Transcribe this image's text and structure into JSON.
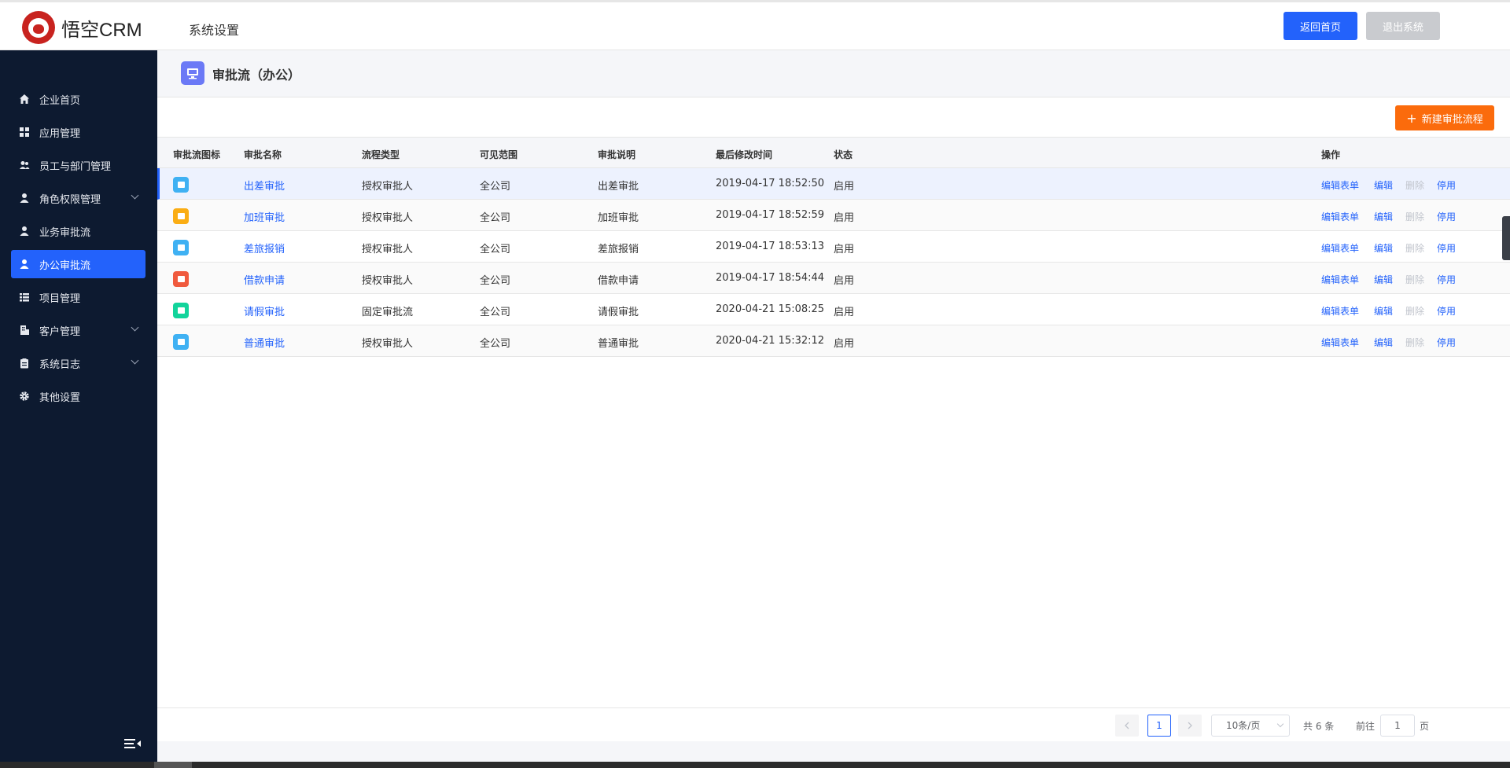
{
  "header": {
    "brand": "悟空CRM",
    "title": "系统设置",
    "home_label": "返回首页",
    "logout_label": "退出系统"
  },
  "sidebar": {
    "items": [
      {
        "label": "企业首页",
        "icon": "home-icon"
      },
      {
        "label": "应用管理",
        "icon": "grid-icon"
      },
      {
        "label": "员工与部门管理",
        "icon": "users-icon"
      },
      {
        "label": "角色权限管理",
        "icon": "user-icon",
        "has_arrow": true
      },
      {
        "label": "业务审批流",
        "icon": "user-icon"
      },
      {
        "label": "办公审批流",
        "icon": "user-icon",
        "active": true
      },
      {
        "label": "项目管理",
        "icon": "list-icon"
      },
      {
        "label": "客户管理",
        "icon": "building-icon",
        "has_arrow": true
      },
      {
        "label": "系统日志",
        "icon": "clipboard-icon",
        "has_arrow": true
      },
      {
        "label": "其他设置",
        "icon": "gear-icon"
      }
    ]
  },
  "page": {
    "title": "审批流（办公）",
    "new_button": "新建审批流程"
  },
  "table": {
    "headers": [
      "审批流图标",
      "审批名称",
      "流程类型",
      "可见范围",
      "审批说明",
      "最后修改时间",
      "状态",
      "操作"
    ],
    "rows": [
      {
        "icon_color": "#3fb1f3",
        "name": "出差审批",
        "type": "授权审批人",
        "scope": "全公司",
        "desc": "出差审批",
        "time": "2019-04-17 18:52:50",
        "status": "启用"
      },
      {
        "icon_color": "#faad14",
        "name": "加班审批",
        "type": "授权审批人",
        "scope": "全公司",
        "desc": "加班审批",
        "time": "2019-04-17 18:52:59",
        "status": "启用"
      },
      {
        "icon_color": "#3fb1f3",
        "name": "差旅报销",
        "type": "授权审批人",
        "scope": "全公司",
        "desc": "差旅报销",
        "time": "2019-04-17 18:53:13",
        "status": "启用"
      },
      {
        "icon_color": "#f05a3e",
        "name": "借款申请",
        "type": "授权审批人",
        "scope": "全公司",
        "desc": "借款申请",
        "time": "2019-04-17 18:54:44",
        "status": "启用"
      },
      {
        "icon_color": "#12d49b",
        "name": "请假审批",
        "type": "固定审批流",
        "scope": "全公司",
        "desc": "请假审批",
        "time": "2020-04-21 15:08:25",
        "status": "启用"
      },
      {
        "icon_color": "#3fb1f3",
        "name": "普通审批",
        "type": "授权审批人",
        "scope": "全公司",
        "desc": "普通审批",
        "time": "2020-04-21 15:32:12",
        "status": "启用"
      }
    ],
    "actions": {
      "edit_form": "编辑表单",
      "edit": "编辑",
      "delete": "删除",
      "disable": "停用"
    }
  },
  "pagination": {
    "current_page": "1",
    "page_size": "10条/页",
    "total": "共 6 条",
    "goto_label": "前往",
    "goto_value": "1",
    "page_suffix": "页"
  },
  "colors": {
    "primary": "#2362fb",
    "accent_orange": "#fb6b0c",
    "sidebar_bg": "#0d1a30"
  }
}
